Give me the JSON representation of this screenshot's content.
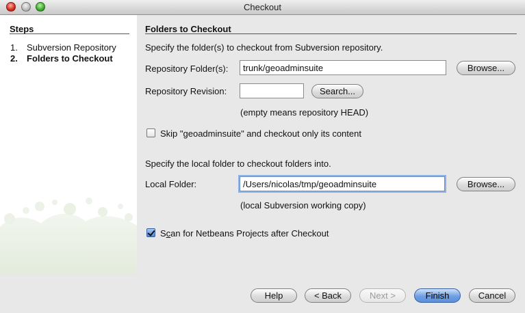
{
  "window": {
    "title": "Checkout"
  },
  "steps": {
    "heading": "Steps",
    "items": [
      {
        "num": "1.",
        "label": "Subversion Repository"
      },
      {
        "num": "2.",
        "label": "Folders to Checkout"
      }
    ]
  },
  "main": {
    "heading": "Folders to Checkout",
    "intro": "Specify the folder(s) to checkout from Subversion repository.",
    "repo_folder": {
      "label": "Repository Folder(s):",
      "value": "trunk/geoadminsuite",
      "browse": "Browse..."
    },
    "repo_revision": {
      "label": "Repository Revision:",
      "value": "",
      "search": "Search...",
      "hint": "(empty means repository HEAD)"
    },
    "skip": {
      "label": "Skip \"geoadminsuite\" and checkout only its content",
      "checked": false
    },
    "local_intro": "Specify the local folder to checkout folders into.",
    "local_folder": {
      "label": "Local Folder:",
      "value": "/Users/nicolas/tmp/geoadminsuite",
      "browse": "Browse...",
      "hint": "(local Subversion working copy)"
    },
    "scan": {
      "label_pre": "S",
      "label_mnemonic": "c",
      "label_post": "an for Netbeans Projects after Checkout",
      "checked": true
    }
  },
  "buttons": {
    "help": "Help",
    "back": "< Back",
    "next": "Next >",
    "finish": "Finish",
    "cancel": "Cancel"
  }
}
